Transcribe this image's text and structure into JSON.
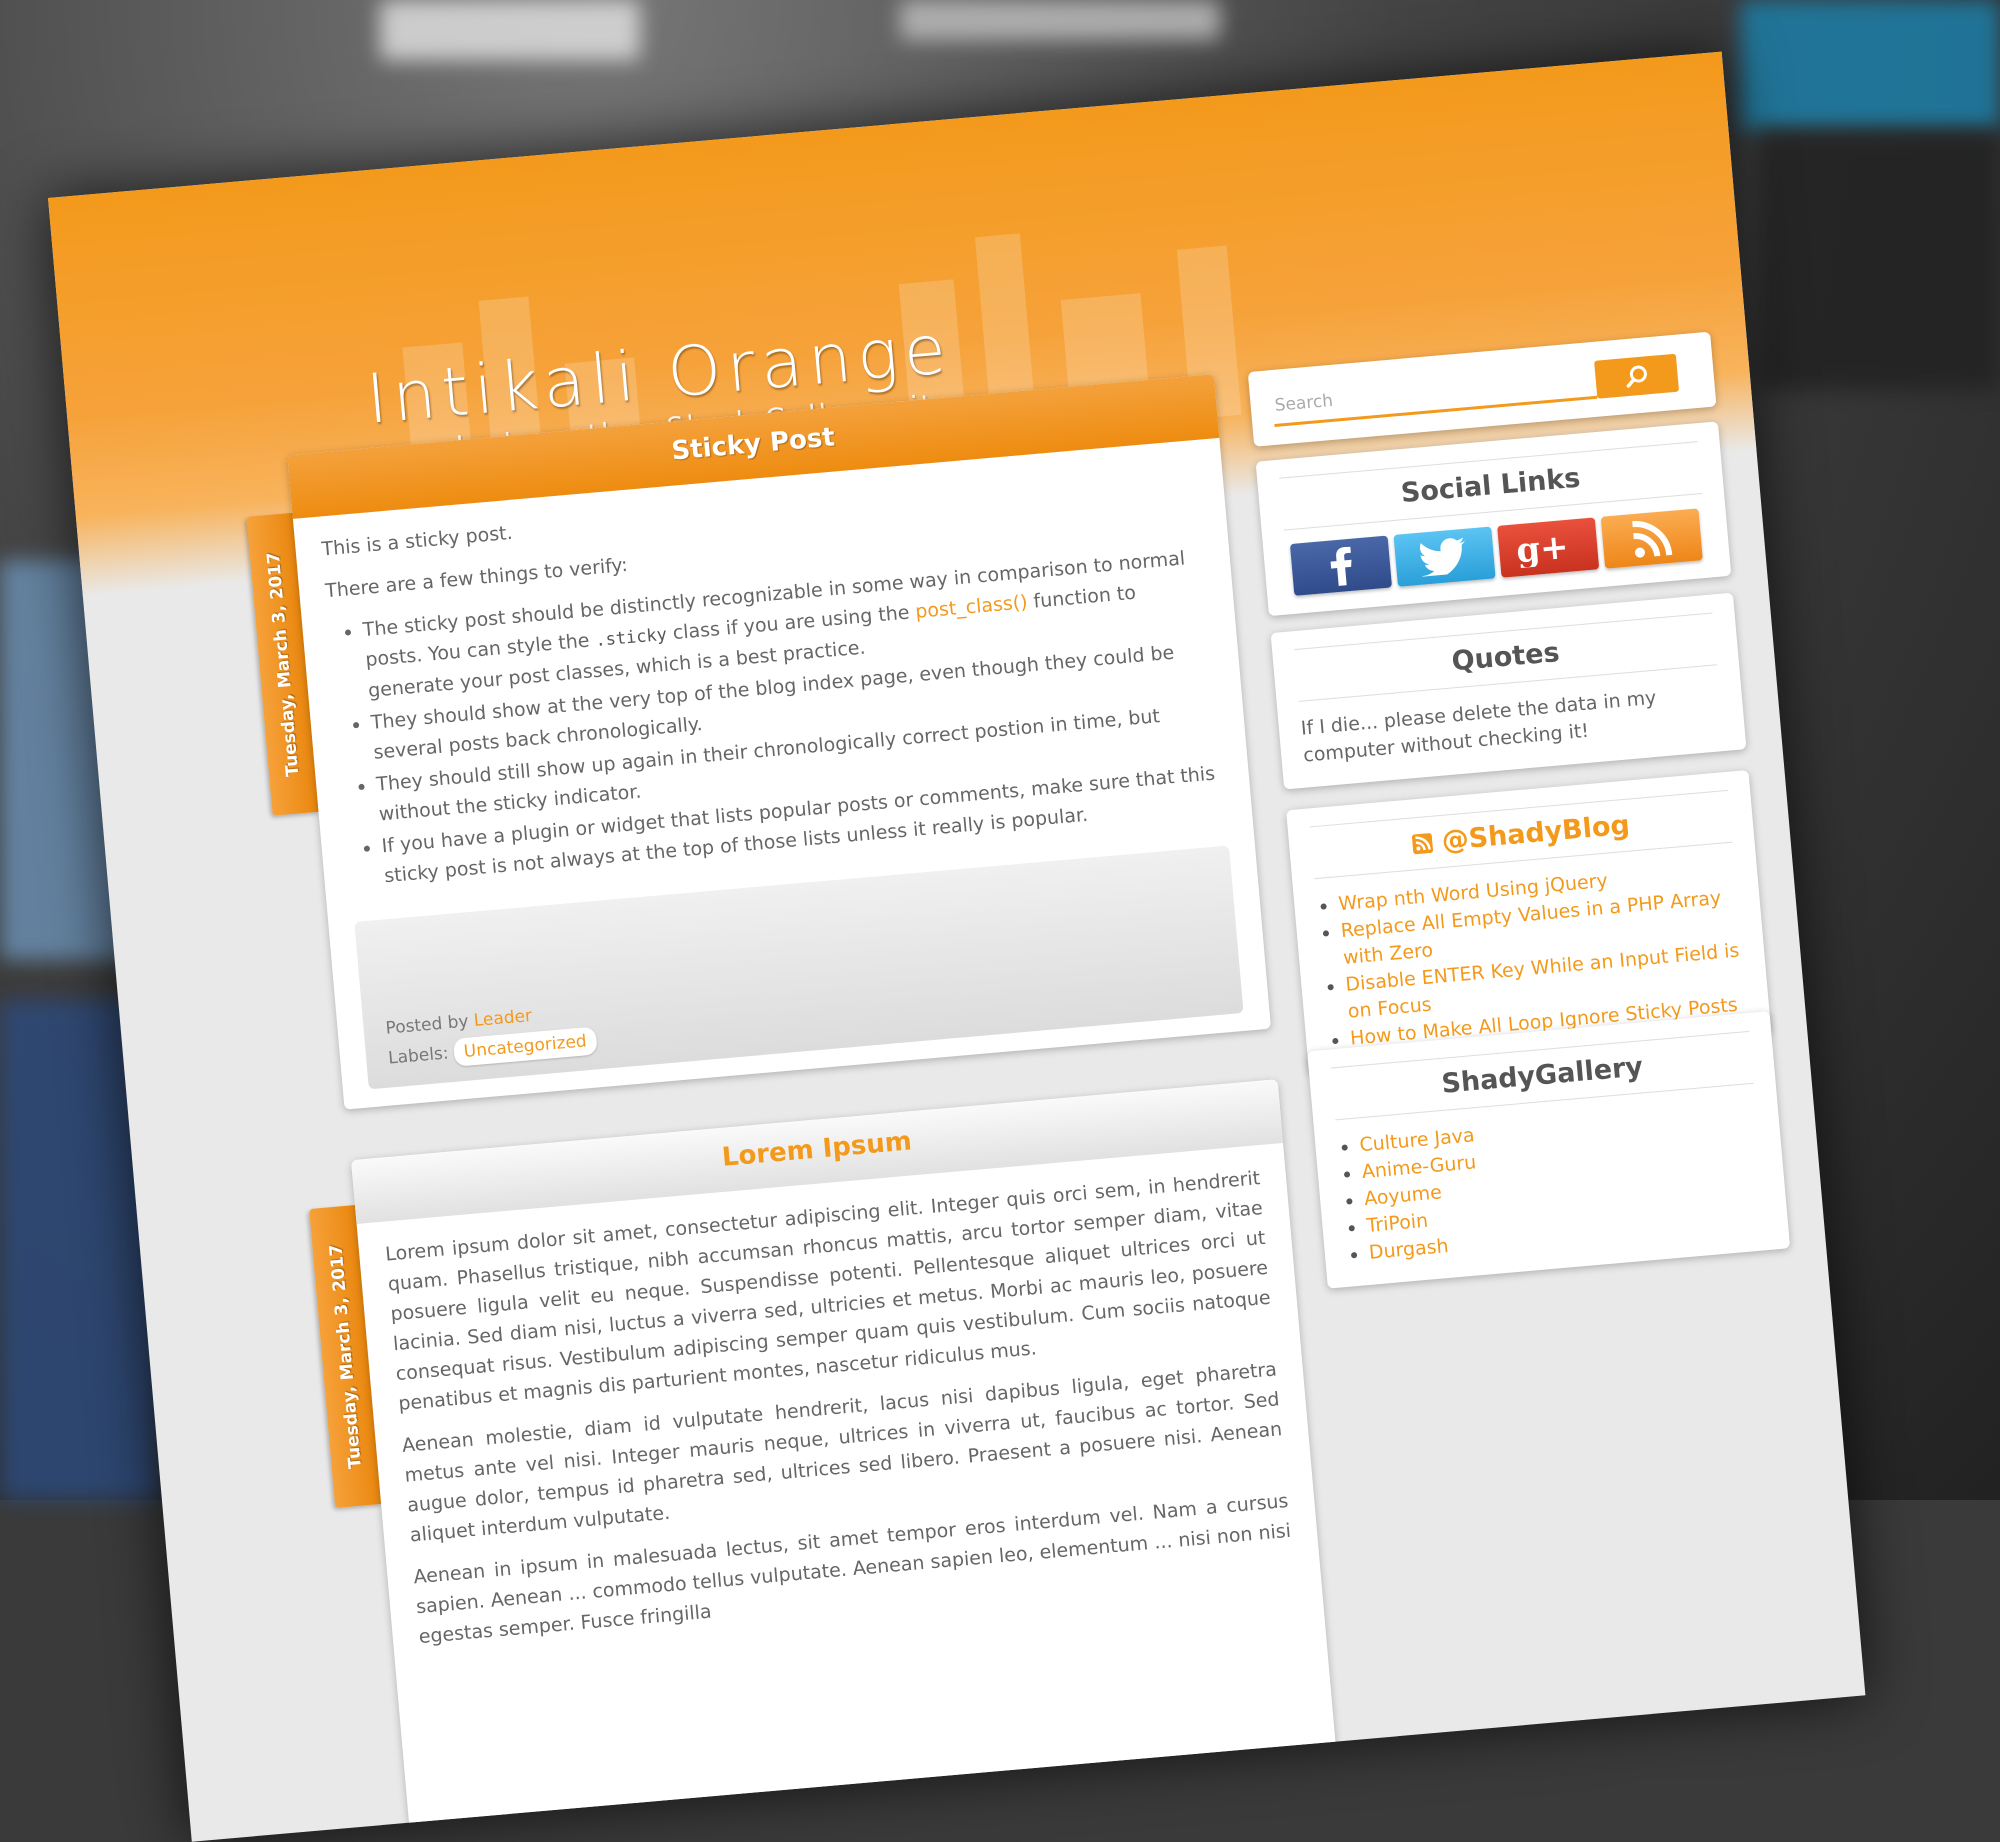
{
  "site": {
    "title": "Intikali Orange",
    "tagline": "Just another ShadyGallery site"
  },
  "search": {
    "placeholder": "Search"
  },
  "posts": [
    {
      "title": "Sticky Post",
      "date": "Tuesday, March 3, 2017",
      "intro": "This is a sticky post.",
      "lead": "There are a few things to verify:",
      "bullets": [
        {
          "before": "The sticky post should be distinctly recognizable in some way in comparison to normal posts. You can style the ",
          "code": ".sticky",
          "middle": " class if you are using the ",
          "link": "post_class()",
          "after": " function to generate your post classes, which is a best practice."
        },
        {
          "text": "They should show at the very top of the blog index page, even though they could be several posts back chronologically."
        },
        {
          "text": "They should still show up again in their chronologically correct postion in time, but without the sticky indicator."
        },
        {
          "text": "If you have a plugin or widget that lists popular posts or comments, make sure that this sticky post is not always at the top of those lists unless it really is popular."
        }
      ],
      "posted_by_label": "Posted by",
      "author": "Leader",
      "labels_label": "Labels:",
      "category": "Uncategorized"
    },
    {
      "title": "Lorem Ipsum",
      "date": "Tuesday, March 3, 2017",
      "paragraphs": [
        "Lorem ipsum dolor sit amet, consectetur adipiscing elit. Integer quis orci sem, in hendrerit quam. Phasellus tristique, nibh accumsan rhoncus mattis, arcu tortor semper diam, vitae posuere ligula velit eu neque. Suspendisse potenti. Pellentesque aliquet ultrices orci ut lacinia. Sed diam nisi, luctus a viverra sed, ultricies et metus. Morbi ac mauris leo, posuere consequat risus. Vestibulum adipiscing semper quam quis vestibulum. Cum sociis natoque penatibus et magnis dis parturient montes, nascetur ridiculus mus.",
        "Aenean molestie, diam id vulputate hendrerit, lacus nisi dapibus ligula, eget pharetra metus ante vel nisi. Integer mauris neque, ultrices in viverra ut, faucibus ac tortor. Sed augue dolor, tempus id pharetra sed, ultrices sed libero. Praesent a posuere nisi. Aenean aliquet interdum vulputate.",
        "Aenean in ipsum in malesuada lectus, sit amet tempor eros interdum vel. Nam a cursus sapien. Aenean ... commodo tellus vulputate. Aenean sapien leo, elementum ... nisi non nisi egestas semper. Fusce fringilla"
      ]
    }
  ],
  "sidebar": {
    "social": {
      "title": "Social Links",
      "icons": [
        "facebook-icon",
        "twitter-icon",
        "google-plus-icon",
        "rss-icon"
      ]
    },
    "quotes": {
      "title": "Quotes",
      "text": "If I die... please delete the data in my computer without checking it!"
    },
    "feed": {
      "title": "@ShadyBlog",
      "items": [
        "Wrap nth Word Using jQuery",
        "Replace All Empty Values in a PHP Array with Zero",
        "Disable ENTER Key While an Input Field is on Focus",
        "How to Make All Loop Ignore Sticky Posts"
      ]
    },
    "gallery": {
      "title": "ShadyGallery",
      "items": [
        "Culture Java",
        "Anime-Guru",
        "Aoyume",
        "TriPoin",
        "Durgash"
      ]
    }
  },
  "colors": {
    "accent": "#f39a1c",
    "page_bg": "#e9e9e9",
    "facebook": "#3b5998",
    "twitter": "#3fb1e8",
    "google_plus": "#dd4b39",
    "rss": "#f4951e"
  }
}
